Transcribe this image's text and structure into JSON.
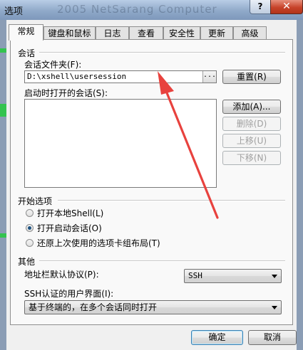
{
  "window": {
    "title": "选项",
    "ghost_title": "2005 NetSarang Computer",
    "help_symbol": "?",
    "close_symbol": "✕"
  },
  "tabs": [
    {
      "label": "常规",
      "active": true
    },
    {
      "label": "键盘和鼠标"
    },
    {
      "label": "日志"
    },
    {
      "label": "查看"
    },
    {
      "label": "安全性"
    },
    {
      "label": "更新"
    },
    {
      "label": "高级"
    }
  ],
  "session_section": {
    "title": "会话",
    "folder_label": "会话文件夹(F):",
    "folder_value": "D:\\xshell\\usersession",
    "browse_label": "...",
    "reset_button": "重置(R)",
    "startup_label": "启动时打开的会话(S):",
    "add_button": "添加(A)...",
    "delete_button": "删除(D)",
    "move_up_button": "上移(U)",
    "move_down_button": "下移(N)"
  },
  "start_options": {
    "title": "开始选项",
    "options": [
      {
        "label": "打开本地Shell(L)",
        "checked": false
      },
      {
        "label": "打开启动会话(O)",
        "checked": true
      },
      {
        "label": "还原上次使用的选项卡组布局(T)",
        "checked": false
      }
    ]
  },
  "other_section": {
    "title": "其他",
    "address_protocol_label": "地址栏默认协议(P):",
    "address_protocol_value": "SSH",
    "ssh_ui_label": "SSH认证的用户界面(I):",
    "ssh_ui_value": "基于终端的，在多个会话同时打开"
  },
  "footer": {
    "ok_button": "确定",
    "cancel_button": "取消"
  },
  "colors": {
    "annotation_arrow": "#e8423e",
    "taskbar_green": "#34c34f"
  }
}
